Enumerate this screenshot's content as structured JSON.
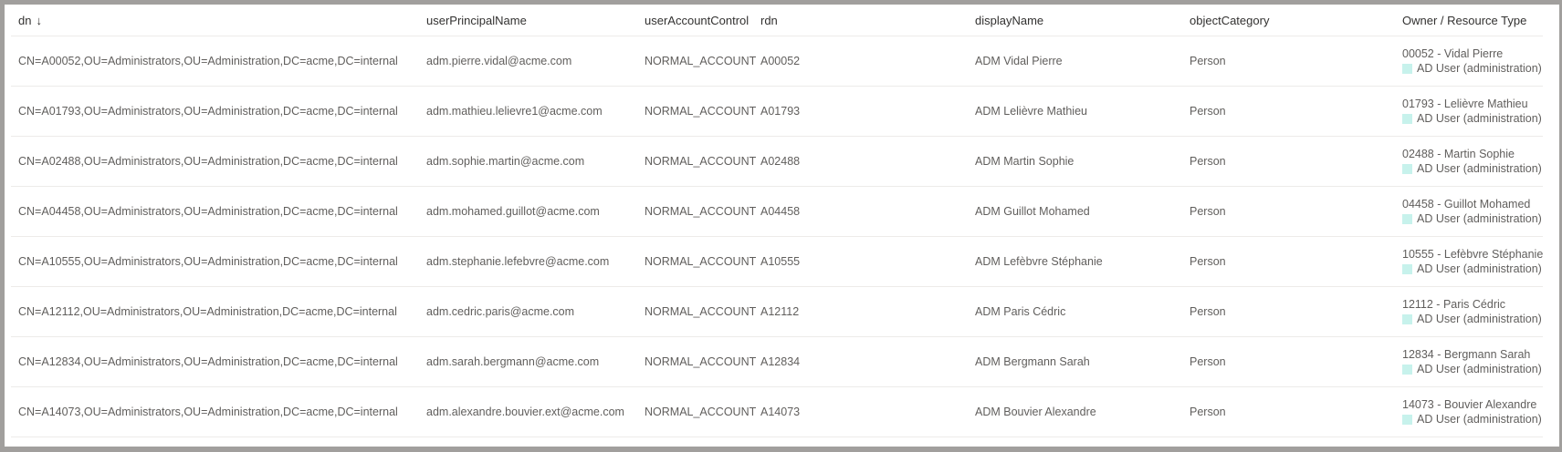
{
  "columns": [
    "dn",
    "userPrincipalName",
    "userAccountControl",
    "rdn",
    "displayName",
    "objectCategory",
    "Owner / Resource Type"
  ],
  "sort_indicator": "↓",
  "type_color": "#c7f2ec",
  "rows": [
    {
      "dn": "CN=A00052,OU=Administrators,OU=Administration,DC=acme,DC=internal",
      "upn": "adm.pierre.vidal@acme.com",
      "uac": "NORMAL_ACCOUNT",
      "rdn": "A00052",
      "displayName": "ADM Vidal Pierre",
      "objectCategory": "Person",
      "owner": "00052 - Vidal Pierre",
      "type": "AD User (administration)"
    },
    {
      "dn": "CN=A01793,OU=Administrators,OU=Administration,DC=acme,DC=internal",
      "upn": "adm.mathieu.lelievre1@acme.com",
      "uac": "NORMAL_ACCOUNT",
      "rdn": "A01793",
      "displayName": "ADM Lelièvre Mathieu",
      "objectCategory": "Person",
      "owner": "01793 - Lelièvre Mathieu",
      "type": "AD User (administration)"
    },
    {
      "dn": "CN=A02488,OU=Administrators,OU=Administration,DC=acme,DC=internal",
      "upn": "adm.sophie.martin@acme.com",
      "uac": "NORMAL_ACCOUNT",
      "rdn": "A02488",
      "displayName": "ADM Martin Sophie",
      "objectCategory": "Person",
      "owner": "02488 - Martin Sophie",
      "type": "AD User (administration)"
    },
    {
      "dn": "CN=A04458,OU=Administrators,OU=Administration,DC=acme,DC=internal",
      "upn": "adm.mohamed.guillot@acme.com",
      "uac": "NORMAL_ACCOUNT",
      "rdn": "A04458",
      "displayName": "ADM Guillot Mohamed",
      "objectCategory": "Person",
      "owner": "04458 - Guillot Mohamed",
      "type": "AD User (administration)"
    },
    {
      "dn": "CN=A10555,OU=Administrators,OU=Administration,DC=acme,DC=internal",
      "upn": "adm.stephanie.lefebvre@acme.com",
      "uac": "NORMAL_ACCOUNT",
      "rdn": "A10555",
      "displayName": "ADM Lefèbvre Stéphanie",
      "objectCategory": "Person",
      "owner": "10555 - Lefèbvre Stéphanie",
      "type": "AD User (administration)"
    },
    {
      "dn": "CN=A12112,OU=Administrators,OU=Administration,DC=acme,DC=internal",
      "upn": "adm.cedric.paris@acme.com",
      "uac": "NORMAL_ACCOUNT",
      "rdn": "A12112",
      "displayName": "ADM Paris Cédric",
      "objectCategory": "Person",
      "owner": "12112 - Paris Cédric",
      "type": "AD User (administration)"
    },
    {
      "dn": "CN=A12834,OU=Administrators,OU=Administration,DC=acme,DC=internal",
      "upn": "adm.sarah.bergmann@acme.com",
      "uac": "NORMAL_ACCOUNT",
      "rdn": "A12834",
      "displayName": "ADM Bergmann Sarah",
      "objectCategory": "Person",
      "owner": "12834 - Bergmann Sarah",
      "type": "AD User (administration)"
    },
    {
      "dn": "CN=A14073,OU=Administrators,OU=Administration,DC=acme,DC=internal",
      "upn": "adm.alexandre.bouvier.ext@acme.com",
      "uac": "NORMAL_ACCOUNT",
      "rdn": "A14073",
      "displayName": "ADM Bouvier Alexandre",
      "objectCategory": "Person",
      "owner": "14073 - Bouvier Alexandre",
      "type": "AD User (administration)"
    }
  ]
}
